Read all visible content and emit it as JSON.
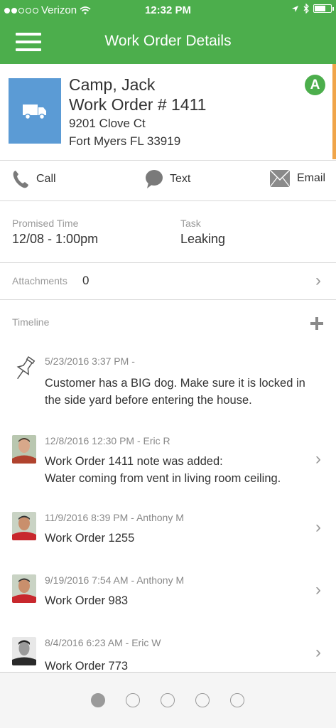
{
  "status": {
    "carrier": "Verizon",
    "time": "12:32 PM"
  },
  "header": {
    "title": "Work Order Details"
  },
  "customer": {
    "name": "Camp, Jack",
    "work_order": "Work Order # 1411",
    "address_line1": "9201 Clove Ct",
    "address_line2": "Fort Myers FL 33919",
    "priority_badge": "A",
    "icon": "truck-icon"
  },
  "contact": {
    "call_label": "Call",
    "text_label": "Text",
    "email_label": "Email"
  },
  "info": {
    "promised_label": "Promised Time",
    "promised_value": "12/08 - 1:00pm",
    "task_label": "Task",
    "task_value": "Leaking"
  },
  "attachments": {
    "label": "Attachments",
    "count": "0"
  },
  "timeline": {
    "label": "Timeline",
    "entries": [
      {
        "date": "5/23/2016 3:37 PM",
        "author": "-",
        "line1": "Customer has a BIG dog. Make sure it is locked in",
        "line2": "the side yard before entering the house.",
        "icon": "pushpin-icon"
      },
      {
        "date": "12/8/2016 12:30 PM",
        "author": "- Eric R",
        "line1": "Work Order 1411 note was added:",
        "line2": "Water coming from vent in living room ceiling."
      },
      {
        "date": "11/9/2016 8:39 PM",
        "author": "- Anthony M",
        "line1": "Work Order 1255"
      },
      {
        "date": "9/19/2016 7:54 AM",
        "author": "- Anthony M",
        "line1": "Work Order 983"
      },
      {
        "date": "8/4/2016 6:23 AM",
        "author": "- Eric W",
        "line1": "Work Order 773"
      }
    ]
  },
  "pager": {
    "pages": 5,
    "active": 1
  },
  "colors": {
    "brand_green": "#4cae4c",
    "truck_blue": "#5b9bd5",
    "accent_orange": "#f0a54a"
  }
}
